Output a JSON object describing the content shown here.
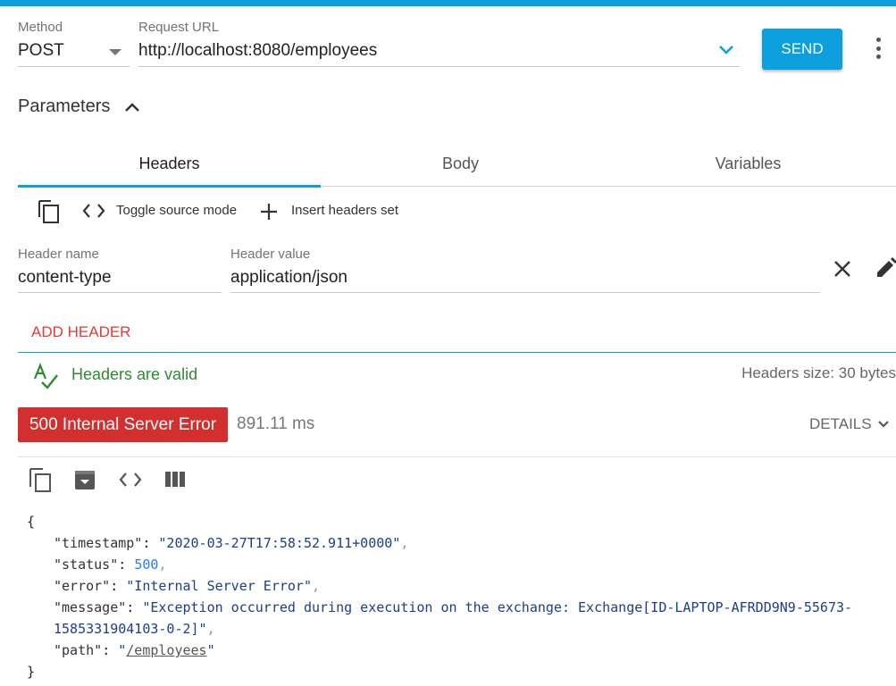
{
  "request": {
    "method_label": "Method",
    "method_value": "POST",
    "url_label": "Request URL",
    "url_value": "http://localhost:8080/employees",
    "send_label": "SEND"
  },
  "parameters": {
    "title": "Parameters",
    "tabs": [
      {
        "label": "Headers",
        "active": true
      },
      {
        "label": "Body",
        "active": false
      },
      {
        "label": "Variables",
        "active": false
      }
    ]
  },
  "headers_toolbar": {
    "toggle_source_label": "Toggle source mode",
    "insert_set_label": "Insert headers set"
  },
  "header_row": {
    "name_label": "Header name",
    "name_value": "content-type",
    "value_label": "Header value",
    "value_value": "application/json"
  },
  "add_header_label": "ADD HEADER",
  "validation": {
    "valid_text": "Headers are valid",
    "size_text": "Headers size: 30 bytes"
  },
  "response": {
    "status_text": "500 Internal Server Error",
    "timing": "891.11 ms",
    "details_label": "DETAILS",
    "status_color": "#d32f2f",
    "body": {
      "timestamp_key": "\"timestamp\"",
      "timestamp_value": "\"2020-03-27T17:58:52.911+0000\"",
      "status_key": "\"status\"",
      "status_value": "500",
      "error_key": "\"error\"",
      "error_value": "\"Internal Server Error\"",
      "message_key": "\"message\"",
      "message_value_line1": "\"Exception occurred during execution on the exchange: Exchange[ID-LAPTOP-AFRDD9N9-55673-",
      "message_value_line2": "1585331904103-0-2]\"",
      "path_key": "\"path\"",
      "path_value": "/employees"
    }
  },
  "colors": {
    "accent": "#0ba0dd",
    "error": "#d32f2f",
    "valid": "#2e8b2e",
    "link_red": "#e53935"
  }
}
